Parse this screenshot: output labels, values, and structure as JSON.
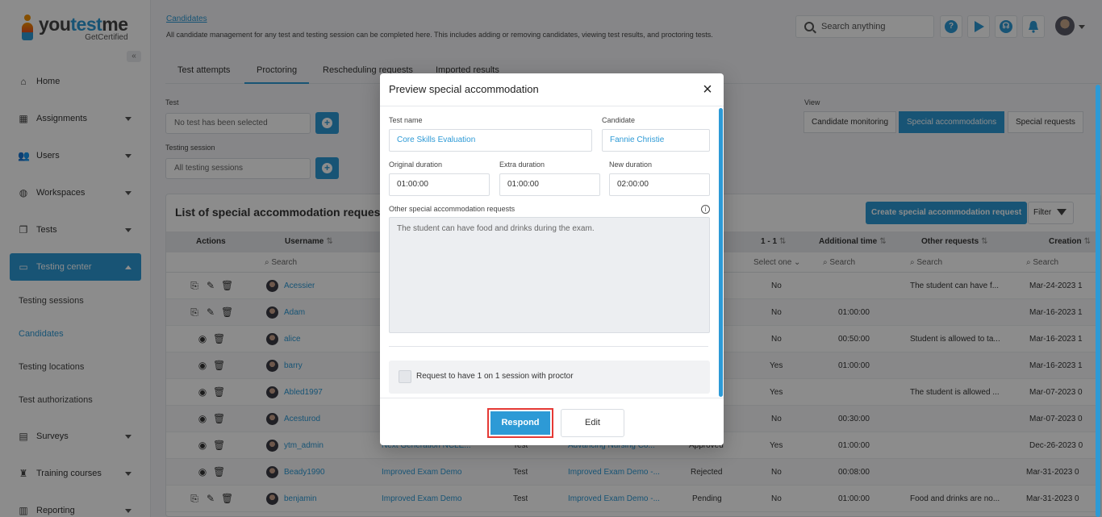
{
  "logo": {
    "brand_start": "you",
    "brand_accent": "test",
    "brand_end": "me",
    "tagline": "GetCertified"
  },
  "sidebar": {
    "items": [
      {
        "label": "Home",
        "icon": "home-icon"
      },
      {
        "label": "Assignments",
        "icon": "assignments-icon"
      },
      {
        "label": "Users",
        "icon": "users-icon"
      },
      {
        "label": "Workspaces",
        "icon": "globe-icon"
      },
      {
        "label": "Tests",
        "icon": "tests-icon"
      },
      {
        "label": "Testing center",
        "icon": "monitor-icon"
      },
      {
        "label": "Surveys",
        "icon": "surveys-icon"
      },
      {
        "label": "Training courses",
        "icon": "trophy-icon"
      },
      {
        "label": "Reporting",
        "icon": "reporting-icon"
      }
    ],
    "sub_items": [
      "Testing sessions",
      "Candidates",
      "Testing locations",
      "Test authorizations"
    ]
  },
  "header": {
    "breadcrumb": "Candidates",
    "description": "All candidate management for any test and testing session can be completed here. This includes adding or removing candidates, viewing test results, and proctoring tests.",
    "search_placeholder": "Search anything"
  },
  "tabs": [
    "Test attempts",
    "Proctoring",
    "Rescheduling requests",
    "Imported results"
  ],
  "filters": {
    "test_label": "Test",
    "test_value": "No test has been selected",
    "session_label": "Testing session",
    "session_value": "All testing sessions",
    "view_label": "View",
    "views": [
      "Candidate monitoring",
      "Special accommodations",
      "Special requests"
    ]
  },
  "table": {
    "title": "List of special accommodation requests",
    "create_button": "Create special accommodation request",
    "filter_button": "Filter",
    "headers": {
      "actions": "Actions",
      "username": "Username",
      "one_on_one": "1 - 1",
      "additional_time": "Additional time",
      "other_requests": "Other requests",
      "creation": "Creation"
    },
    "sort_glyph": "⇅",
    "search_placeholder": "Search",
    "select_one": "Select one",
    "rows": [
      {
        "user": "Acessier",
        "test": "",
        "type": "",
        "session": "",
        "status": "",
        "one": "No",
        "time": "",
        "other": "The student can have f...",
        "created": "Mar-24-2023 1"
      },
      {
        "user": "Adam",
        "test": "",
        "type": "",
        "session": "",
        "status": "",
        "one": "No",
        "time": "01:00:00",
        "other": "",
        "created": "Mar-16-2023 1"
      },
      {
        "user": "alice",
        "test": "",
        "type": "",
        "session": "",
        "status": "",
        "one": "No",
        "time": "00:50:00",
        "other": "Student is allowed to ta...",
        "created": "Mar-16-2023 1"
      },
      {
        "user": "barry",
        "test": "",
        "type": "",
        "session": "",
        "status": "",
        "one": "Yes",
        "time": "01:00:00",
        "other": "",
        "created": "Mar-16-2023 1"
      },
      {
        "user": "Abled1997",
        "test": "",
        "type": "",
        "session": "",
        "status": "",
        "one": "Yes",
        "time": "",
        "other": "The student is allowed ...",
        "created": "Mar-07-2023 0"
      },
      {
        "user": "Acesturod",
        "test": "",
        "type": "",
        "session": "",
        "status": "",
        "one": "No",
        "time": "00:30:00",
        "other": "",
        "created": "Mar-07-2023 0"
      },
      {
        "user": "ytm_admin",
        "test": "Next Generation NCLE...",
        "type": "Test",
        "session": "Advancing Nursing Co...",
        "status": "Approved",
        "one": "Yes",
        "time": "01:00:00",
        "other": "",
        "created": "Dec-26-2023 0"
      },
      {
        "user": "Beady1990",
        "test": "Improved Exam Demo",
        "type": "Test",
        "session": "Improved Exam Demo -...",
        "status": "Rejected",
        "one": "No",
        "time": "00:08:00",
        "other": "",
        "created": "Mar-31-2023 0"
      },
      {
        "user": "benjamin",
        "test": "Improved Exam Demo",
        "type": "Test",
        "session": "Improved Exam Demo -...",
        "status": "Pending",
        "one": "No",
        "time": "01:00:00",
        "other": "Food and drinks are no...",
        "created": "Mar-31-2023 0"
      }
    ]
  },
  "modal": {
    "title": "Preview special accommodation",
    "test_name_label": "Test name",
    "test_name": "Core Skills Evaluation",
    "candidate_label": "Candidate",
    "candidate": "Fannie Christie",
    "original_label": "Original duration",
    "original": "01:00:00",
    "extra_label": "Extra duration",
    "extra": "01:00:00",
    "new_label": "New duration",
    "new": "02:00:00",
    "other_label": "Other special accommodation requests",
    "other_text": "The student can have food and drinks during the exam.",
    "one_on_one_label": "Request to have 1 on 1 session with proctor",
    "respond": "Respond",
    "edit": "Edit"
  },
  "colors": {
    "accent": "#2d9ad6",
    "highlight": "#e53935"
  }
}
